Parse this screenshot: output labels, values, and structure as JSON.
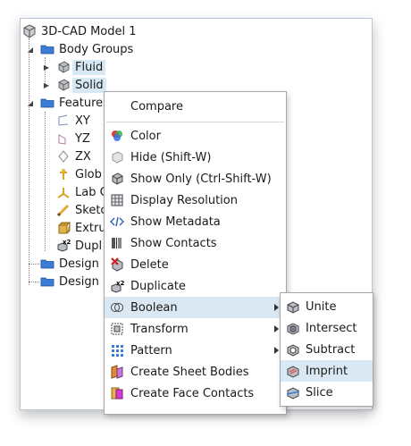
{
  "tree": {
    "root": {
      "label": "3D-CAD Model 1",
      "icon": "cad-model-icon"
    },
    "body_groups": {
      "label": "Body Groups",
      "icon": "folder-icon"
    },
    "fluid": {
      "label": "Fluid",
      "icon": "body-icon"
    },
    "solid": {
      "label": "Solid",
      "icon": "body-icon"
    },
    "features": {
      "label": "Features",
      "icon": "folder-icon"
    },
    "children": [
      {
        "label": "XY",
        "icon": "plane-xy-icon"
      },
      {
        "label": "YZ",
        "icon": "plane-yz-icon"
      },
      {
        "label": "ZX",
        "icon": "plane-zx-icon"
      },
      {
        "label": "Glob",
        "icon": "global-cs-icon"
      },
      {
        "label": "Lab C",
        "icon": "lab-cs-icon"
      },
      {
        "label": "Sketc",
        "icon": "sketch-icon"
      },
      {
        "label": "Extru",
        "icon": "extrude-icon"
      },
      {
        "label": "Dupl",
        "icon": "duplicate-icon"
      }
    ],
    "design1": {
      "label": "Design I",
      "icon": "folder-icon"
    },
    "design2": {
      "label": "Design I",
      "icon": "folder-icon"
    }
  },
  "context_menu": {
    "compare": "Compare",
    "items": [
      {
        "label": "Color",
        "icon": "color-icon"
      },
      {
        "label": "Hide (Shift-W)",
        "icon": "hide-icon"
      },
      {
        "label": "Show Only (Ctrl-Shift-W)",
        "icon": "show-only-icon"
      },
      {
        "label": "Display Resolution",
        "icon": "display-resolution-icon"
      },
      {
        "label": "Show Metadata",
        "icon": "metadata-icon"
      },
      {
        "label": "Show Contacts",
        "icon": "contacts-icon"
      },
      {
        "label": "Delete",
        "icon": "delete-icon"
      },
      {
        "label": "Duplicate",
        "icon": "duplicate-icon"
      },
      {
        "label": "Boolean",
        "icon": "boolean-icon",
        "submenu": true
      },
      {
        "label": "Transform",
        "icon": "transform-icon",
        "submenu": true
      },
      {
        "label": "Pattern",
        "icon": "pattern-icon",
        "submenu": true
      },
      {
        "label": "Create Sheet Bodies",
        "icon": "sheet-bodies-icon"
      },
      {
        "label": "Create Face Contacts",
        "icon": "face-contacts-icon"
      }
    ],
    "highlighted": "Boolean"
  },
  "boolean_submenu": {
    "items": [
      {
        "label": "Unite",
        "icon": "unite-icon"
      },
      {
        "label": "Intersect",
        "icon": "intersect-icon"
      },
      {
        "label": "Subtract",
        "icon": "subtract-icon"
      },
      {
        "label": "Imprint",
        "icon": "imprint-icon"
      },
      {
        "label": "Slice",
        "icon": "slice-icon"
      }
    ],
    "highlighted": "Imprint"
  },
  "colors": {
    "selection": "#d6e8f4",
    "menu_highlight": "#d9e8f3",
    "folder": "#2e6fc7"
  }
}
